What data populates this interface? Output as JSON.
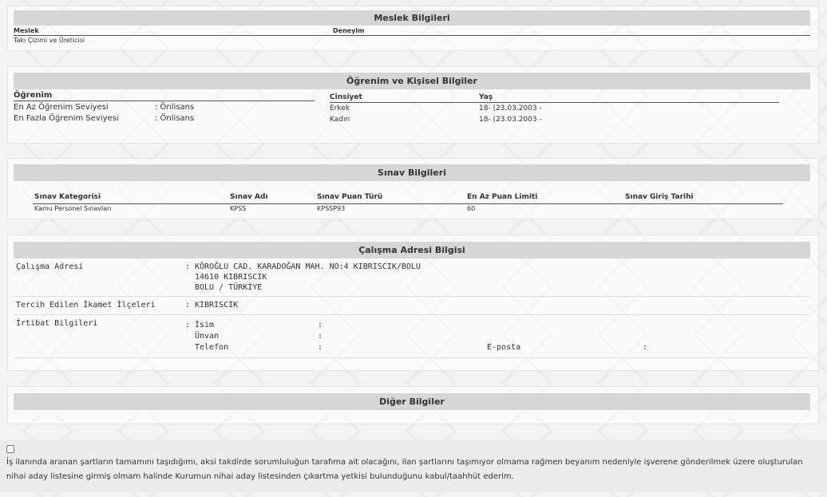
{
  "meslek": {
    "title": "Meslek Bilgileri",
    "col_meslek": "Meslek",
    "col_deneyim": "Deneyim",
    "value": "Takı Çizimi ve Üreticisi"
  },
  "ogrenim": {
    "title": "Öğrenim ve Kişisel Bilgiler",
    "col_ogrenim": "Öğrenim",
    "min_label": "En Az Öğrenim Seviyesi",
    "min_value": ":  Önlisans",
    "max_label": "En Fazla Öğrenim Seviyesi",
    "max_value": ":  Önlisans",
    "col_cinsiyet": "Cinsiyet",
    "col_yas": "Yaş",
    "rows": [
      {
        "cinsiyet": "Erkek",
        "yas": "18- (23.03.2003 -"
      },
      {
        "cinsiyet": "Kadın",
        "yas": "18- (23.03.2003 -"
      }
    ]
  },
  "sinav": {
    "title": "Sınav Bilgileri",
    "headers": [
      "Sınav Kategorisi",
      "Sınav Adı",
      "Sınav Puan Türü",
      "En Az Puan Limiti",
      "Sınav Giriş Tarihi"
    ],
    "row": [
      "Kamu Personel Sınavları",
      "KPSS",
      "KPSSP93",
      "60",
      ""
    ]
  },
  "adres": {
    "title": "Çalışma Adresi Bilgisi",
    "calisma_label": "Çalışma Adresi",
    "colon": ":",
    "address_lines": [
      "KÖROĞLU CAD. KARADOĞAN MAH. NO:4 KIBRISCIK/BOLU",
      "14610 KIBRISCIK",
      "BOLU / TÜRKİYE"
    ],
    "tercih_label": "Tercih Edilen İkamet İlçeleri",
    "tercih_value": "KIBRISCIK",
    "irtibat_label": "İrtibat Bilgileri",
    "isim_label": "İsim",
    "unvan_label": "Ünvan",
    "telefon_label": "Telefon",
    "eposta_label": "E-posta"
  },
  "diger": {
    "title": "Diğer Bilgiler"
  },
  "declaration": {
    "text": "İş ilanında aranan şartların tamamını taşıdığımı, aksi takdirde sorumluluğun tarafıma ait olacağını, ilan şartlarını taşımıyor olmama rağmen beyanım nedeniyle işverene gönderilmek üzere oluşturulan nihai aday listesine girmiş olmam halinde Kurumun nihai aday listesinden çıkartma yetkisi bulunduğunu kabul/taahhüt ederim."
  }
}
